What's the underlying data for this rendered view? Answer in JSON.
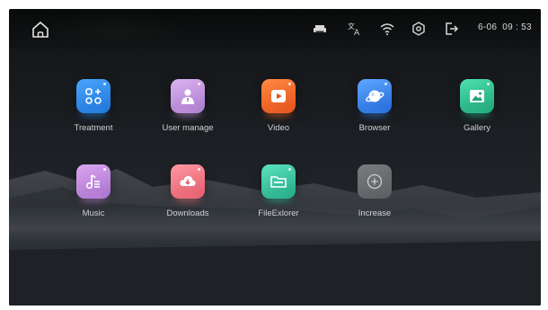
{
  "status_bar": {
    "home_icon": "home-icon",
    "icons": [
      "printer-icon",
      "translate-icon",
      "wifi-icon",
      "settings-gear-icon",
      "logout-icon"
    ],
    "date": "6-06",
    "time": "09 : 53"
  },
  "apps": [
    {
      "label": "Treatment",
      "icon": "grid-plus-icon",
      "color": "#2f8ff0"
    },
    {
      "label": "User manage",
      "icon": "user-icon",
      "color": "#c79be0"
    },
    {
      "label": "Video",
      "icon": "video-play-icon",
      "color": "#f06b2a"
    },
    {
      "label": "Browser",
      "icon": "planet-icon",
      "color": "#3a8cf0"
    },
    {
      "label": "Gallery",
      "icon": "image-icon",
      "color": "#2fc48f"
    },
    {
      "label": "Music",
      "icon": "music-icon",
      "color": "#c98be0"
    },
    {
      "label": "Downloads",
      "icon": "cloud-download-icon",
      "color": "#f07a86"
    },
    {
      "label": "FileExlorer",
      "icon": "folder-icon",
      "color": "#35c7a0"
    },
    {
      "label": "Increase",
      "icon": "plus-circle-icon",
      "color": "#6e7074"
    }
  ]
}
